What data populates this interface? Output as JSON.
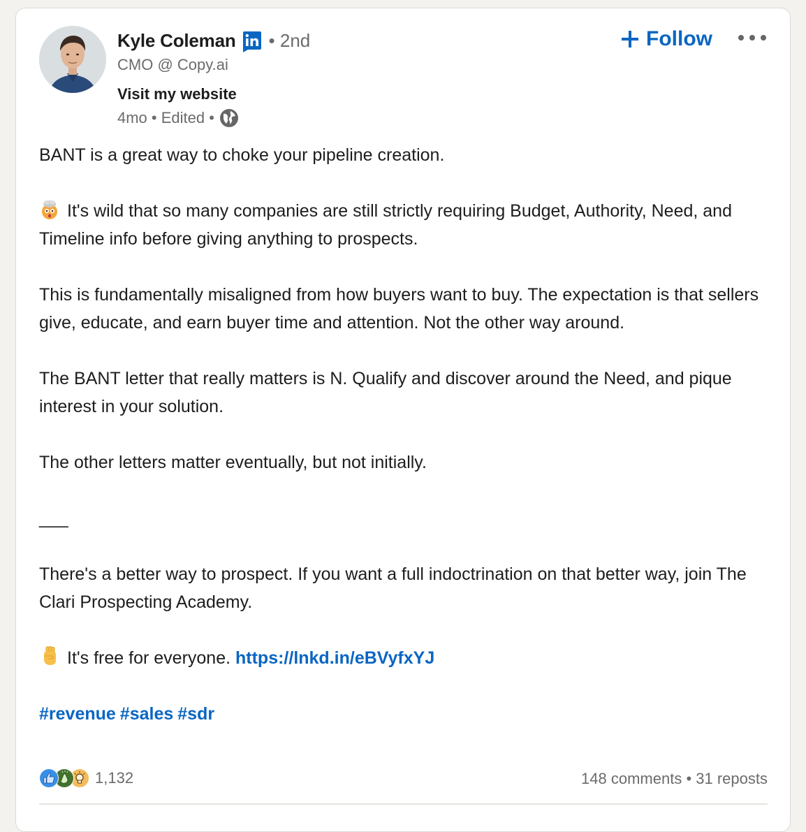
{
  "author": {
    "name": "Kyle Coleman",
    "badge_icon": "linkedin-premium-icon",
    "connection_degree": "• 2nd",
    "headline": "CMO @ Copy.ai",
    "website_link": "Visit my website",
    "timestamp": "4mo",
    "edited": "Edited",
    "separator": "•",
    "visibility_icon": "globe-icon"
  },
  "actions": {
    "follow_label": "Follow",
    "follow_icon": "plus-icon",
    "more_icon": "ellipsis-icon"
  },
  "post": {
    "paragraphs": [
      "BANT is a great way to choke your pipeline creation.",
      "It's wild that so many companies are still strictly requiring Budget, Authority, Need, and Timeline info before giving anything to prospects.",
      "This is fundamentally misaligned from how buyers want to buy. The expectation is that sellers give, educate, and earn buyer time and attention. Not the other way around.",
      "The BANT letter that really matters is N. Qualify and discover around the Need, and pique interest in your solution.",
      "The other letters matter eventually, but not initially.",
      "___",
      "There's a better way to prospect. If you want a full indoctrination on that better way, join The Clari Prospecting Academy.",
      "It's free for everyone."
    ],
    "emoji_1": "exploding-head-emoji",
    "emoji_2": "raised-fist-emoji",
    "link": "https://lnkd.in/eBVyfxYJ",
    "hashtags": [
      "#revenue",
      "#sales",
      "#sdr"
    ]
  },
  "engagement": {
    "reaction_icons": [
      "like-icon",
      "celebrate-icon",
      "insightful-icon"
    ],
    "reaction_count": "1,132",
    "comments": "148 comments",
    "separator": " • ",
    "reposts": "31 reposts"
  },
  "colors": {
    "brand_blue": "#0a66c2",
    "text_primary": "#1d1d1d",
    "text_secondary": "#6b6b6b",
    "page_bg": "#f4f2ee"
  }
}
